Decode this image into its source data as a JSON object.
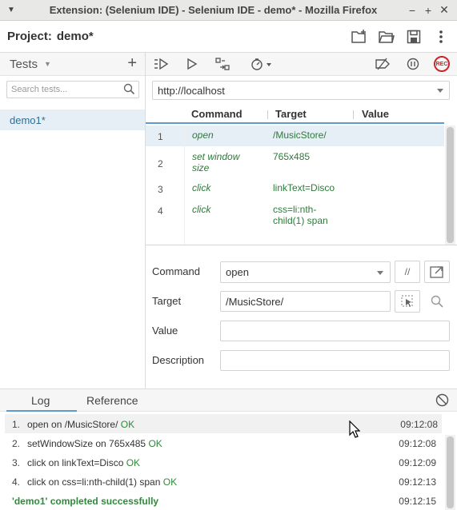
{
  "window": {
    "title": "Extension: (Selenium IDE) - Selenium IDE - demo* - Mozilla Firefox",
    "minimize": "−",
    "maximize": "+",
    "close": "✕"
  },
  "project": {
    "label": "Project:",
    "name": "demo*"
  },
  "sidebar": {
    "header": "Tests",
    "search_placeholder": "Search tests...",
    "tests": [
      {
        "name": "demo1*",
        "selected": true
      }
    ]
  },
  "toolbar": {
    "rec_label": "REC"
  },
  "url": {
    "value": "http://localhost"
  },
  "commands_table": {
    "columns": [
      "Command",
      "Target",
      "Value"
    ],
    "rows": [
      {
        "num": "1",
        "command": "open",
        "target": "/MusicStore/",
        "value": ""
      },
      {
        "num": "2",
        "command": "set window size",
        "target": "765x485",
        "value": ""
      },
      {
        "num": "3",
        "command": "click",
        "target": "linkText=Disco",
        "value": ""
      },
      {
        "num": "4",
        "command": "click",
        "target": "css=li:nth-child(1) span",
        "value": ""
      }
    ]
  },
  "editor": {
    "command_label": "Command",
    "command_value": "open",
    "comment_btn": "//",
    "target_label": "Target",
    "target_value": "/MusicStore/",
    "value_label": "Value",
    "value_value": "",
    "description_label": "Description",
    "description_value": ""
  },
  "log": {
    "tabs": [
      "Log",
      "Reference"
    ],
    "active_tab": "Log",
    "entries": [
      {
        "n": "1.",
        "text": "open on /MusicStore/",
        "status": "OK",
        "time": "09:12:08"
      },
      {
        "n": "2.",
        "text": "setWindowSize on 765x485",
        "status": "OK",
        "time": "09:12:08"
      },
      {
        "n": "3.",
        "text": "click on linkText=Disco",
        "status": "OK",
        "time": "09:12:09"
      },
      {
        "n": "4.",
        "text": "click on css=li:nth-child(1) span",
        "status": "OK",
        "time": "09:12:13"
      }
    ],
    "summary": {
      "text": "'demo1' completed successfully",
      "time": "09:12:15"
    }
  },
  "colors": {
    "accent": "#5b9bd1",
    "success": "#2e8a3a",
    "command_text": "#2d7a3a",
    "rec": "#c9252c",
    "selection": "#e7eff6"
  }
}
